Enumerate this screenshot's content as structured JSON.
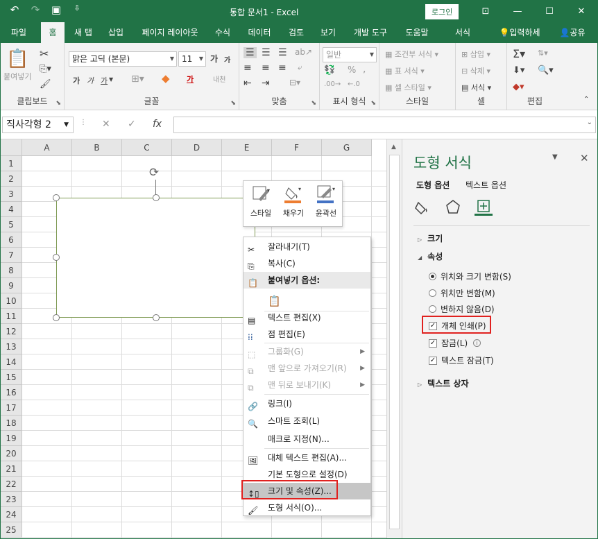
{
  "window": {
    "title": "통합 문서1 - Excel",
    "login_label": "로그인",
    "qat": {
      "undo": "↶",
      "redo": "↷",
      "save": "▣",
      "customize": "⇩"
    },
    "controls": {
      "ribbon_options": "⊡",
      "minimize": "—",
      "maximize": "☐",
      "close": "✕"
    }
  },
  "ribbon_tabs": [
    "파일",
    "홈",
    "새 탭",
    "삽입",
    "페이지 레이아웃",
    "수식",
    "데이터",
    "검토",
    "보기",
    "개발 도구",
    "도움말",
    "서식"
  ],
  "active_tab": "홈",
  "tell_me": "입력하세",
  "share": "공유",
  "ribbon": {
    "clipboard": {
      "label": "클립보드",
      "paste": "붙여넣기"
    },
    "font": {
      "label": "글꼴",
      "font_name": "맑은 고딕 (본문)",
      "font_size": "11",
      "bold": "가",
      "italic": "가",
      "underline": "가",
      "grow": "가",
      "shrink": "가",
      "phonetic": "내천"
    },
    "alignment": {
      "label": "맞춤"
    },
    "number": {
      "label": "표시 형식",
      "format": "일반",
      "percent": "%",
      "comma": ","
    },
    "styles": {
      "label": "스타일",
      "conditional": "조건부 서식",
      "table": "표 서식",
      "cell_styles": "셀 스타일"
    },
    "cells": {
      "label": "셀",
      "insert": "삽입",
      "delete": "삭제",
      "format": "서식"
    },
    "editing": {
      "label": "편집"
    }
  },
  "formula_bar": {
    "name_box": "직사각형 2",
    "fx": "fx",
    "value": ""
  },
  "sheet": {
    "columns": [
      "A",
      "B",
      "C",
      "D",
      "E",
      "F",
      "G"
    ],
    "rows": [
      "1",
      "2",
      "3",
      "4",
      "5",
      "6",
      "7",
      "8",
      "9",
      "10",
      "11",
      "12",
      "13",
      "14",
      "15",
      "16",
      "17",
      "18",
      "19",
      "20",
      "21",
      "22",
      "23",
      "24",
      "25"
    ]
  },
  "mini_toolbar": {
    "style": "스타일",
    "fill": "채우기",
    "outline": "윤곽선"
  },
  "context_menu": {
    "cut": "잘라내기(T)",
    "copy": "복사(C)",
    "paste_options": "붙여넣기 옵션:",
    "edit_text": "텍스트 편집(X)",
    "edit_points": "점 편집(E)",
    "group": "그룹화(G)",
    "bring_front": "맨 앞으로 가져오기(R)",
    "send_back": "맨 뒤로 보내기(K)",
    "link": "링크(I)",
    "smart_lookup": "스마트 조회(L)",
    "assign_macro": "매크로 지정(N)...",
    "alt_text": "대체 텍스트 편집(A)...",
    "set_default": "기본 도형으로 설정(D)",
    "size_properties": "크기 및 속성(Z)...",
    "format_shape": "도형 서식(O)..."
  },
  "pane": {
    "title": "도형 서식",
    "tab_shape": "도형 옵션",
    "tab_text": "텍스트 옵션",
    "size": "크기",
    "properties": "속성",
    "radio_move_size": "위치와 크기 변함(S)",
    "radio_move_only": "위치만 변함(M)",
    "radio_none": "변하지 않음(D)",
    "print_object": "개체 인쇄(P)",
    "locked": "잠금(L)",
    "lock_text": "텍스트 잠금(T)",
    "textbox": "텍스트 상자",
    "selected_radio": "위치와 크기 변함(S)",
    "checked": {
      "print_object": true,
      "locked": true,
      "lock_text": true
    }
  },
  "colors": {
    "brand": "#217346",
    "highlight": "#e0211f",
    "fill_accent": "#ed7d31",
    "outline_accent": "#4472c4"
  }
}
